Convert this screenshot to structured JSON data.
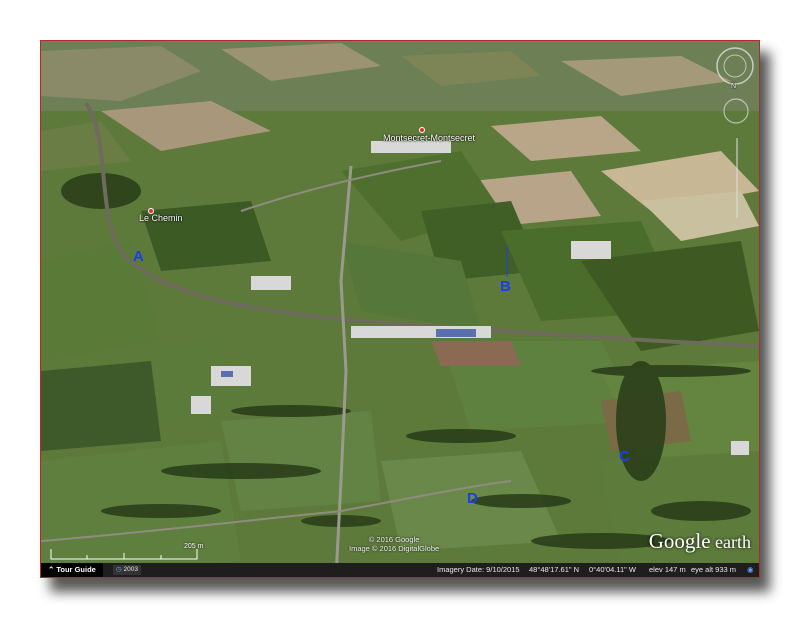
{
  "markers": [
    {
      "label": "A",
      "color": "#1a3df0"
    },
    {
      "label": "B",
      "color": "#1a3df0"
    },
    {
      "label": "C",
      "color": "#1a3df0"
    },
    {
      "label": "D",
      "color": "#1a3df0"
    }
  ],
  "places": {
    "village_top": "Montsecret-Montsecret",
    "village_left": "Le Chemin"
  },
  "copyright": {
    "line1": "© 2016 Google",
    "line2": "Image © 2016 DigitalGlobe"
  },
  "logo": {
    "google": "Google",
    "earth": "earth"
  },
  "scale": {
    "label": "205 m"
  },
  "statusbar": {
    "tour_guide": "Tour Guide",
    "year": "2003",
    "imagery_date": "Imagery Date: 9/10/2015",
    "lat": "48°48'17.61\" N",
    "lon": "0°40'04.11\" W",
    "elev": "elev  147 m",
    "eye_alt": "eye alt  933 m"
  },
  "navigation": {
    "north_label": "N"
  },
  "colors": {
    "frame_border": "#b42a2a",
    "marker": "#1a3df0",
    "field_green": "#5f7a3d"
  }
}
